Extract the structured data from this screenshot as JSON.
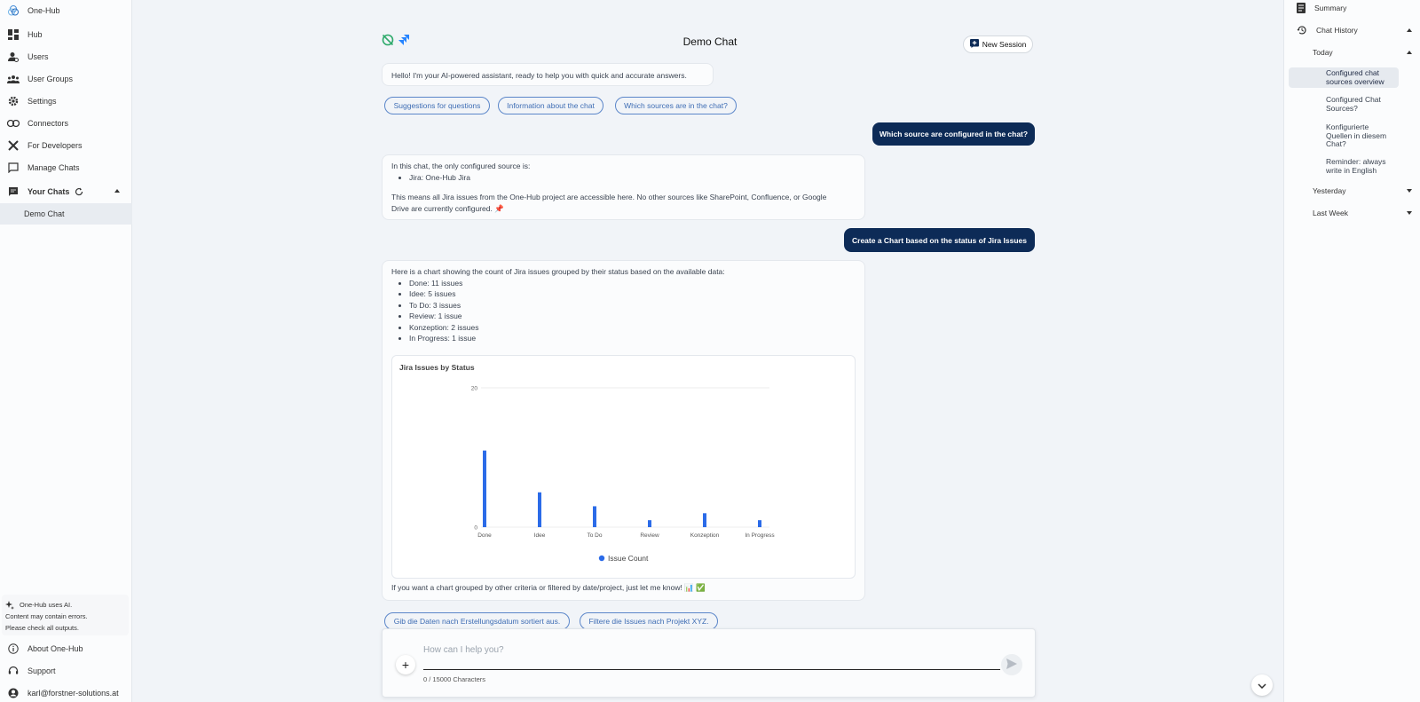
{
  "sidebar": {
    "brand": "One-Hub",
    "items": [
      {
        "label": "Hub"
      },
      {
        "label": "Users"
      },
      {
        "label": "User Groups"
      },
      {
        "label": "Settings"
      },
      {
        "label": "Connectors"
      },
      {
        "label": "For Developers"
      },
      {
        "label": "Manage Chats"
      }
    ],
    "your_chats": "Your Chats",
    "active_chat": "Demo Chat",
    "ai_note": {
      "line1": "One-Hub uses AI.",
      "line2": "Content may contain errors.",
      "line3": "Please check all outputs."
    },
    "about": "About One-Hub",
    "support": "Support",
    "user_email": "karl@forstner-solutions.at"
  },
  "header": {
    "title": "Demo Chat",
    "new_session": "New Session"
  },
  "chat": {
    "greeting": "Hello! I'm your AI-powered assistant, ready to help you with quick and accurate answers.",
    "suggestions": [
      "Suggestions for questions",
      "Information about the chat",
      "Which sources are in the chat?"
    ],
    "user_msg_1": "Which source are configured in the chat?",
    "reply_1": {
      "intro": "In this chat, the only configured source is:",
      "bullet": "Jira: One-Hub Jira",
      "outro_line1": "This means all Jira issues from the One-Hub project are accessible here. No other sources like SharePoint, Confluence, or Google",
      "outro_line2": "Drive are currently configured. 📌"
    },
    "user_msg_2": "Create a Chart based on the status of Jira Issues",
    "reply_2": {
      "intro": "Here is a chart showing the count of Jira issues grouped by their status based on the available data:",
      "bullets": [
        "Done: 11 issues",
        "Idee: 5 issues",
        "To Do: 3 issues",
        "Review: 1 issue",
        "Konzeption: 2 issues",
        "In Progress: 1 issue"
      ],
      "outro": "If you want a chart grouped by other criteria or filtered by date/project, just let me know! 📊 ✅"
    },
    "followups": [
      "Gib die Daten nach Erstellungsdatum sortiert aus.",
      "Filtere die Issues nach Projekt XYZ."
    ]
  },
  "chart_data": {
    "type": "bar",
    "title": "Jira Issues by Status",
    "categories": [
      "Done",
      "Idee",
      "To Do",
      "Review",
      "Konzeption",
      "In Progress"
    ],
    "series": [
      {
        "name": "Issue Count",
        "values": [
          11,
          5,
          3,
          1,
          2,
          1
        ]
      }
    ],
    "yticks": [
      "0",
      "20"
    ],
    "ylim": [
      0,
      20
    ],
    "legend": "bottom",
    "color": "#2b6be8"
  },
  "composer": {
    "placeholder": "How can I help you?",
    "count": "0 / 15000 Characters"
  },
  "right": {
    "summary": "Summary",
    "chat_history": "Chat History",
    "today": "Today",
    "history": [
      {
        "line1": "Configured chat",
        "line2": "sources overview",
        "line3": ""
      },
      {
        "line1": "Configured Chat",
        "line2": "Sources?",
        "line3": ""
      },
      {
        "line1": "Konfigurierte",
        "line2": "Quellen in diesem",
        "line3": "Chat?"
      },
      {
        "line1": "Reminder: always",
        "line2": "write in English",
        "line3": ""
      }
    ],
    "yesterday": "Yesterday",
    "last_week": "Last Week"
  },
  "colors": {
    "accent": "#0d2b57",
    "chip": "#3e6db4",
    "bar": "#2b6be8"
  }
}
